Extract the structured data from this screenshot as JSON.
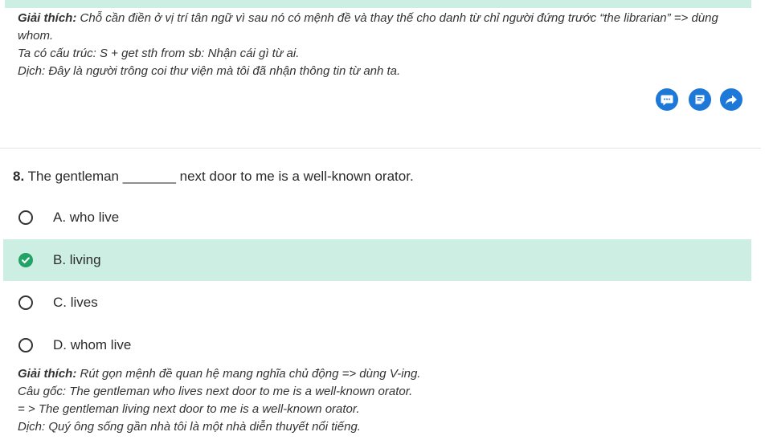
{
  "previous_question": {
    "explanation_title": "Giải thích:",
    "explanation_text": "Chỗ cần điền ở vị trí tân ngữ vì sau nó có mệnh đề và thay thế cho danh từ chỉ người đứng trước “the librarian” => dùng whom.",
    "structure_line": "Ta có cấu trúc: S + get sth from sb: Nhận cái gì từ ai.",
    "translation_line": "Dịch: Đây là người trông coi thư viện mà tôi đã nhận thông tin từ anh ta."
  },
  "actions": {
    "icons": [
      "comment-icon",
      "note-icon",
      "share-icon"
    ],
    "color": "#1e78d7"
  },
  "question": {
    "number": "8.",
    "text": "The gentleman _______ next door to me is a well-known orator."
  },
  "options": [
    {
      "label": "A. who live",
      "correct": false
    },
    {
      "label": "B. living",
      "correct": true
    },
    {
      "label": "C. lives",
      "correct": false
    },
    {
      "label": "D. whom live",
      "correct": false
    }
  ],
  "explanation": {
    "title": "Giải thích:",
    "text": "Rút gọn mệnh đề quan hệ mang nghĩa chủ động => dùng V-ing.",
    "original_line": "Câu gốc: The gentleman who lives next door to me is a well-known orator.",
    "reduced_line": "= > The gentleman living next door to me is a well-known orator.",
    "translation_line": "Dịch: Quý ông sống gần nhà tôi là một nhà diễn thuyết nổi tiếng."
  },
  "colors": {
    "correct_bg": "#cdeee2",
    "check_green": "#21a366",
    "accent_blue": "#1e78d7"
  }
}
